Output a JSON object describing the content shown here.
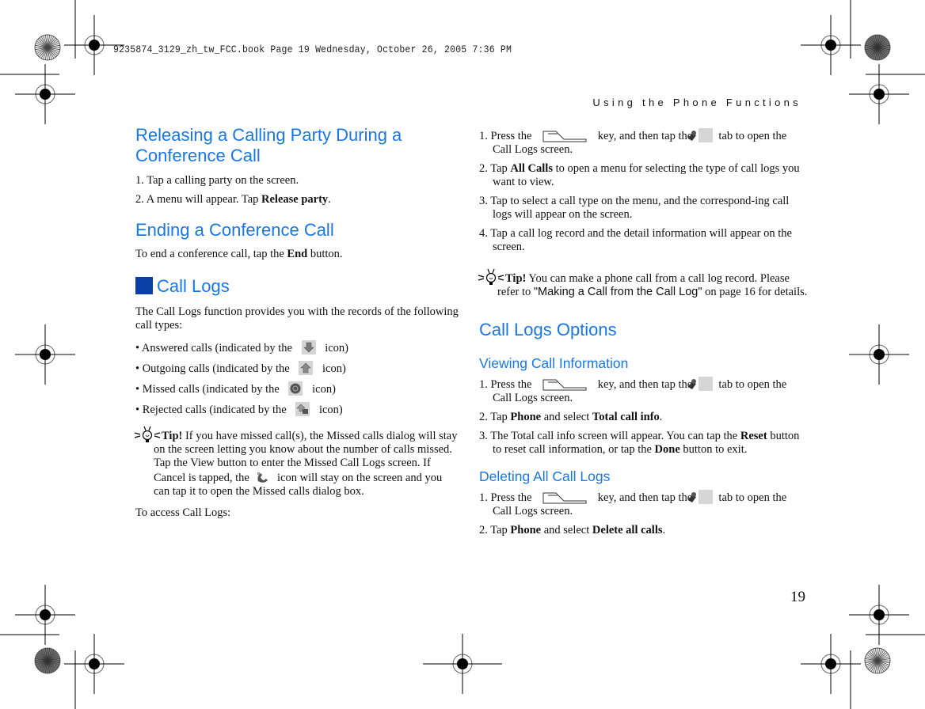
{
  "slug": "9235874_3129_zh_tw_FCC.book  Page 19  Wednesday, October 26, 2005  7:36 PM",
  "running_head": "Using the Phone Functions",
  "page_number": "19",
  "left": {
    "h_release": "Releasing a Calling Party During a Conference Call",
    "release_steps": [
      {
        "num": "1.",
        "text": "Tap a calling party on the screen."
      },
      {
        "num": "2.",
        "pre": "A menu will appear. Tap ",
        "bold": "Release party",
        "post": "."
      }
    ],
    "h_ending": "Ending a Conference Call",
    "ending_text": {
      "pre": "To end a conference call, tap the ",
      "bold": "End",
      "post": " button."
    },
    "h_call_logs": "Call Logs",
    "intro": "The Call Logs function provides you with the records of the following call types:",
    "call_types": [
      {
        "pre": "• Answered calls (indicated by the",
        "icon": "answered-call-icon",
        "post": "icon)"
      },
      {
        "pre": "• Outgoing calls (indicated by the",
        "icon": "outgoing-call-icon",
        "post": "icon)"
      },
      {
        "pre": "• Missed calls (indicated by the",
        "icon": "missed-call-icon",
        "post": "icon)"
      },
      {
        "pre": "• Rejected calls (indicated by the",
        "icon": "rejected-call-icon",
        "post": "icon)"
      }
    ],
    "tip": {
      "label": "Tip!",
      "pre": " If you have missed call(s), the Missed calls dialog will stay on the screen letting you know about the number of calls missed. Tap the View button to enter the Missed Call Logs screen. If Cancel is tapped, the",
      "post": "icon will stay on the screen and you can tap it to open the Missed calls dialog box."
    },
    "access": "To access Call Logs:"
  },
  "right": {
    "access_steps": [
      {
        "num": "1.",
        "pre": "Press the",
        "mid": "key, and then tap the",
        "post": "tab to open the Call Logs screen."
      },
      {
        "num": "2.",
        "pre": "Tap ",
        "bold": "All Calls",
        "post": " to open a menu for selecting the type of call logs you want to view."
      },
      {
        "num": "3.",
        "text": "Tap to select a call type on the menu, and the correspond-ing call logs will appear on the screen."
      },
      {
        "num": "4.",
        "text": "Tap a call log record and the detail information will appear on the screen."
      }
    ],
    "tip": {
      "label": "Tip!",
      "pre": " You can make a phone call from a call log record. Please refer to ",
      "quote": "\"Making a Call from the Call Log\"",
      "post": " on page 16 for details."
    },
    "h_options": "Call Logs Options",
    "h_viewing": "Viewing Call Information",
    "viewing_steps": [
      {
        "num": "1.",
        "pre": "Press the",
        "mid": "key, and then tap the",
        "post": "tab to open the Call Logs screen."
      },
      {
        "num": "2.",
        "pre": "Tap ",
        "bold": "Phone",
        "mid": " and select ",
        "bold2": "Total call info",
        "post": "."
      },
      {
        "num": "3.",
        "pre": "The Total call info screen will appear. You can tap the ",
        "bold": "Reset",
        "mid": " button to reset call information, or tap the ",
        "bold2": "Done",
        "post": " button to exit."
      }
    ],
    "h_deleting": "Deleting All Call Logs",
    "deleting_steps": [
      {
        "num": "1.",
        "pre": "Press the",
        "mid": "key, and then tap the",
        "post": "tab to open the Call Logs screen."
      },
      {
        "num": "2.",
        "pre": "Tap ",
        "bold": "Phone",
        "mid": " and select ",
        "bold2": "Delete all calls",
        "post": "."
      }
    ]
  },
  "colors": {
    "heading_blue": "#1877e6",
    "section_square": "#0b3fa8",
    "tab_icon_bg": "#d6d6d6"
  }
}
